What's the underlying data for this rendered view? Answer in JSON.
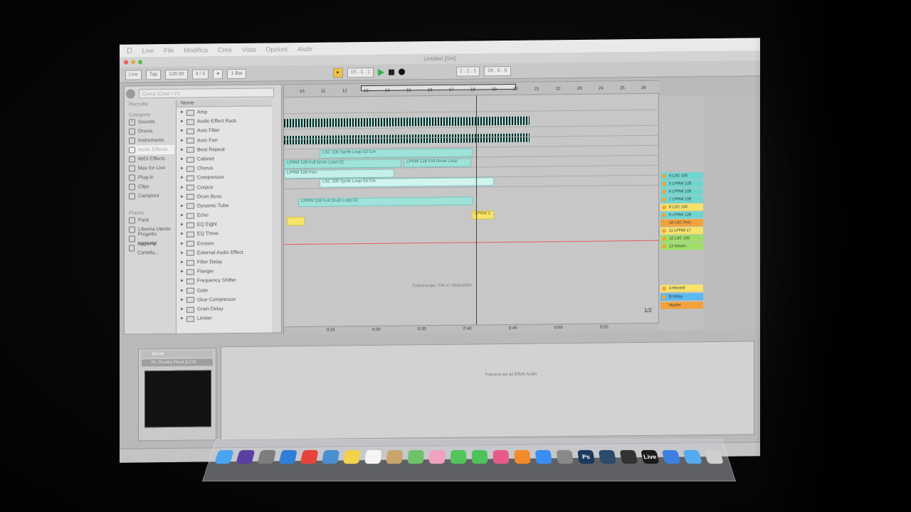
{
  "app": {
    "name": "Live",
    "menu": [
      "Live",
      "File",
      "Modifica",
      "Crea",
      "Vista",
      "Opzioni",
      "Aiuto"
    ],
    "window_title": "Untitled [Set]"
  },
  "transport": {
    "tap": "Tap",
    "tempo": "128.00",
    "signature": "4 / 4",
    "quantize": "1 Bar",
    "position": "15 . 1 . 1",
    "loop_start": "1 . 1 . 1",
    "loop_length": "24 . 0 . 0"
  },
  "browser": {
    "search_placeholder": "Cerca (Cmd + F)",
    "collections_header": "Raccolte",
    "categories_header": "Categorie",
    "categories": [
      "Sounds",
      "Drums",
      "Instruments",
      "Audio Effects",
      "MIDI Effects",
      "Max for Live",
      "Plug-in",
      "Clips",
      "Campioni"
    ],
    "places_header": "Places",
    "places": [
      "Pack",
      "Libreria Utente",
      "Progetto corrente",
      "Aggiungi Cartella..."
    ],
    "name_header": "Nome",
    "effects": [
      "Amp",
      "Audio Effect Rack",
      "Auto Filter",
      "Auto Pan",
      "Beat Repeat",
      "Cabinet",
      "Chorus",
      "Compressor",
      "Corpus",
      "Drum Buss",
      "Dynamic Tube",
      "Echo",
      "EQ Eight",
      "EQ Three",
      "Erosion",
      "External Audio Effect",
      "Filter Delay",
      "Flanger",
      "Frequency Shifter",
      "Gate",
      "Glue Compressor",
      "Grain Delay",
      "Limiter"
    ]
  },
  "arrangement": {
    "bars": [
      "10",
      "11",
      "12",
      "13",
      "14",
      "15",
      "16",
      "17",
      "18",
      "19",
      "20",
      "21",
      "22",
      "23",
      "24",
      "25",
      "26"
    ],
    "clips": [
      "LSC 100 Synth Loop 03 Cm",
      "LPRW 128 Full Drum Loop 02",
      "LPRW 128 Full Drum Loop",
      "LPRW 128 Perc",
      "LSC 100 Synth Loop 03 Cm",
      "LPRW 128 Full Drum Loop 02",
      "LPRW 1"
    ],
    "drop_text": "Trascina qui i File e i Dispositivi",
    "times": [
      "0:25",
      "0:30",
      "0:35",
      "0:40",
      "0:45",
      "0:50",
      "0:55"
    ],
    "page": "1/2"
  },
  "mixer": {
    "tracks": [
      "4 LSC 100",
      "5 LPRW 128",
      "6 LPRW 128",
      "7 LPRW 128",
      "8 LSC 100",
      "9 LPRW 128",
      "10 LSC Perc",
      "11 LPRW 17",
      "12 LSC 100",
      "13 Serum"
    ],
    "returns": [
      "A Reverb",
      "B Delay",
      "Master"
    ],
    "colors": {
      "teal": "#6fd6cf",
      "yellow": "#f5e36a",
      "orange": "#f2a23b",
      "green": "#9ee067",
      "blue": "#59b9f0"
    }
  },
  "detail": {
    "device_name": "Serum",
    "preset_name": "PL Chunky Pluck [LCV]",
    "fx_drop_text": "Trascina qui gli Effetti Audio"
  },
  "dock": {
    "icons": [
      "finder-icon",
      "siri-icon",
      "launchpad-icon",
      "safari-icon",
      "chrome-icon",
      "preview-icon",
      "notes-icon",
      "calendar-icon",
      "contacts-icon",
      "maps-icon",
      "photos-icon",
      "messages-icon",
      "facetime-icon",
      "itunes-icon",
      "ibooks-icon",
      "appstore-icon",
      "system-preferences-icon",
      "photoshop-icon",
      "lightroom-icon",
      "unity-icon",
      "ableton-live-icon",
      "dropbox-icon",
      "folder-icon",
      "trash-icon"
    ],
    "labels": {
      "photoshop": "Ps",
      "live": "Live"
    }
  }
}
